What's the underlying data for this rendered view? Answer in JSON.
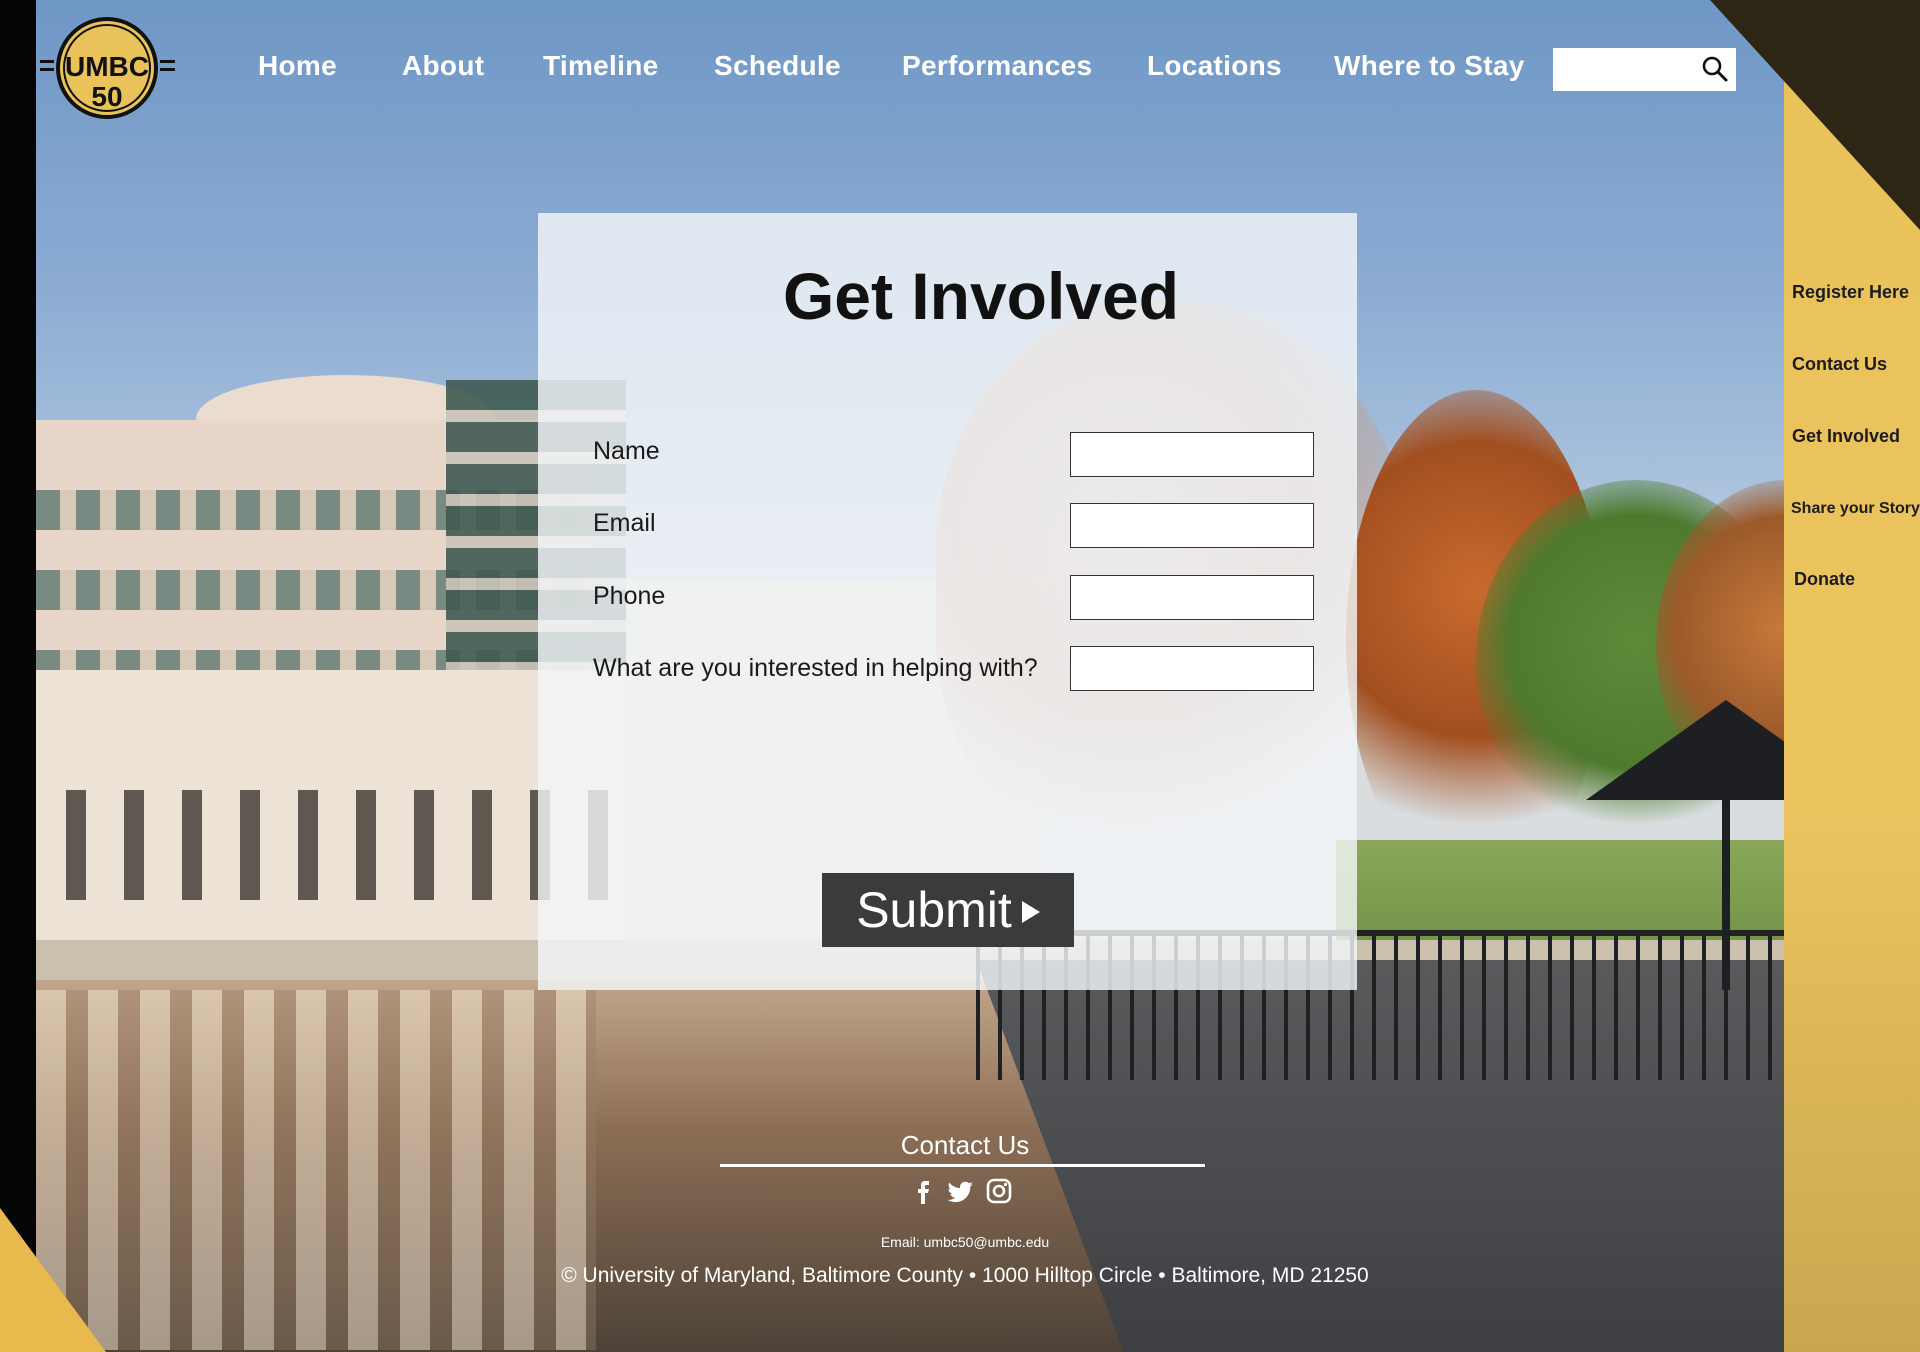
{
  "brand": {
    "logo_text": "UMBC",
    "logo_number": "50",
    "colors": {
      "gold": "#e9c25a",
      "dark": "#2e2615",
      "button": "#3b3b3d"
    }
  },
  "nav": {
    "items": [
      {
        "label": "Home"
      },
      {
        "label": "About"
      },
      {
        "label": "Timeline"
      },
      {
        "label": "Schedule"
      },
      {
        "label": "Performances"
      },
      {
        "label": "Locations"
      },
      {
        "label": "Where to Stay"
      }
    ],
    "search": {
      "value": "",
      "icon": "search-icon"
    }
  },
  "sidebar": {
    "items": [
      {
        "label": "Register Here"
      },
      {
        "label": "Contact Us"
      },
      {
        "label": "Get Involved"
      },
      {
        "label": "Share your Story"
      },
      {
        "label": "Donate"
      }
    ]
  },
  "form": {
    "title": "Get Involved",
    "fields": [
      {
        "label": "Name",
        "value": ""
      },
      {
        "label": "Email",
        "value": ""
      },
      {
        "label": "Phone",
        "value": ""
      },
      {
        "label": "What are you interested in helping with?",
        "value": ""
      }
    ],
    "submit_label": "Submit"
  },
  "footer": {
    "heading": "Contact Us",
    "social": [
      "facebook-icon",
      "twitter-icon",
      "instagram-icon"
    ],
    "email": "Email: umbc50@umbc.edu",
    "address": "© University of Maryland, Baltimore County • 1000 Hilltop Circle • Baltimore, MD 21250"
  }
}
